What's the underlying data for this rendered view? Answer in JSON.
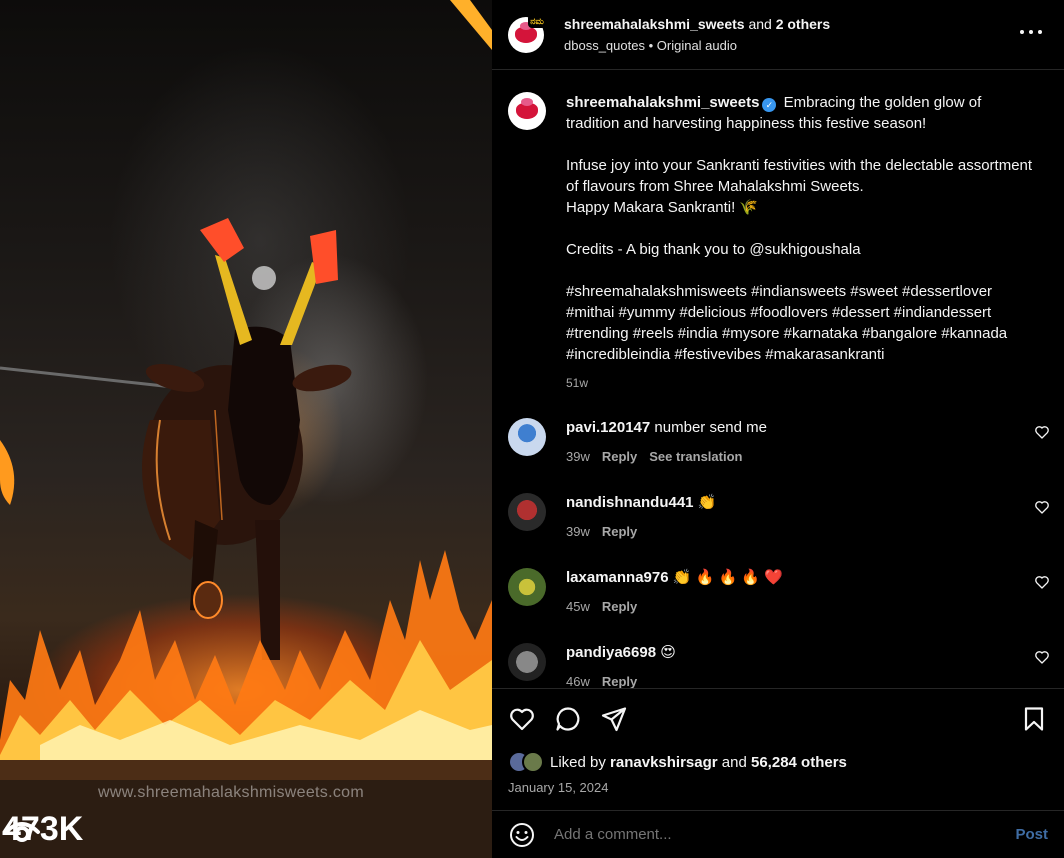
{
  "media": {
    "watermark": "www.shreemahalakshmisweets.com",
    "view_count": "473K"
  },
  "header": {
    "author": "shreemahalakshmi_sweets",
    "and_text": "and",
    "others": "2 others",
    "audio_user": "dboss_quotes",
    "audio_separator": "•",
    "audio_label": "Original audio",
    "collab_badge": "ನಮ"
  },
  "caption": {
    "user": "shreemahalakshmi_sweets",
    "verified_mark": "✓",
    "line1": "Embracing the golden glow of tradition and harvesting happiness this festive season!",
    "line2": "Infuse joy into your Sankranti festivities with the delectable assortment of flavours from Shree Mahalakshmi Sweets.",
    "line3": "Happy Makara Sankranti! 🌾",
    "line4": "Credits - A big thank you to @sukhigoushala",
    "hashtags": "#shreemahalakshmisweets #indiansweets #sweet #dessertlover #mithai #yummy #delicious #foodlovers #dessert #indiandessert #trending #reels #india #mysore #karnataka #bangalore #kannada #incredibleindia #festivevibes #makarasankranti",
    "time": "51w"
  },
  "comments": [
    {
      "user": "pavi.120147",
      "text": "number send me",
      "time": "39w",
      "reply": "Reply",
      "translate": "See translation"
    },
    {
      "user": "nandishnandu441",
      "text": "👏",
      "time": "39w",
      "reply": "Reply"
    },
    {
      "user": "laxamanna976",
      "text": "👏 🔥 🔥 🔥 ❤️",
      "time": "45w",
      "reply": "Reply"
    },
    {
      "user": "pandiya6698",
      "text": "😍",
      "time": "46w",
      "reply": "Reply"
    }
  ],
  "likes": {
    "prefix": "Liked by",
    "user": "ranavkshirsagr",
    "and_text": "and",
    "count": "56,284 others"
  },
  "date": "January 15, 2024",
  "add_comment": {
    "placeholder": "Add a comment...",
    "post_label": "Post"
  }
}
